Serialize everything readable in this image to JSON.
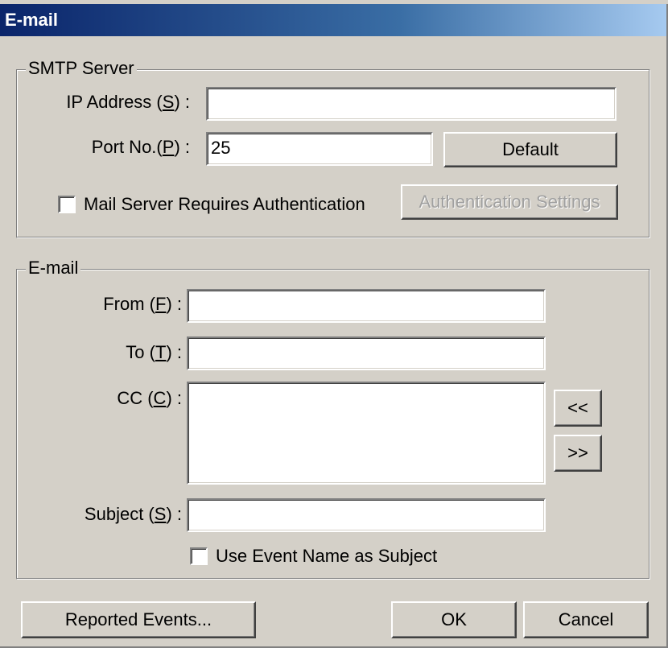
{
  "window": {
    "title": "E-mail"
  },
  "smtp_group": {
    "legend": "SMTP Server",
    "ip_label_pre": "IP Address (",
    "ip_label_acc": "S",
    "ip_label_post": ") :",
    "ip_value": "",
    "port_label_pre": "Port No.(",
    "port_label_acc": "P",
    "port_label_post": ") :",
    "port_value": "25",
    "default_button": "Default",
    "auth_checkbox_label": "Mail Server Requires Authentication",
    "auth_checked": false,
    "auth_settings_button": "Authentication Settings"
  },
  "email_group": {
    "legend": "E-mail",
    "from_label_pre": "From (",
    "from_label_acc": "F",
    "from_label_post": ") :",
    "from_value": "",
    "to_label_pre": "To (",
    "to_label_acc": "T",
    "to_label_post": ") :",
    "to_value": "",
    "cc_label_pre": "CC (",
    "cc_label_acc": "C",
    "cc_label_post": ") :",
    "cc_value": "",
    "cc_add_button": "<<",
    "cc_open_button": ">>",
    "subject_label_pre": "Subject (",
    "subject_label_acc": "S",
    "subject_label_post": ") :",
    "subject_value": "",
    "event_name_checkbox_label": "Use Event Name as Subject",
    "event_name_checked": false
  },
  "footer": {
    "reported_events_button": "Reported Events...",
    "ok_button": "OK",
    "cancel_button": "Cancel"
  }
}
